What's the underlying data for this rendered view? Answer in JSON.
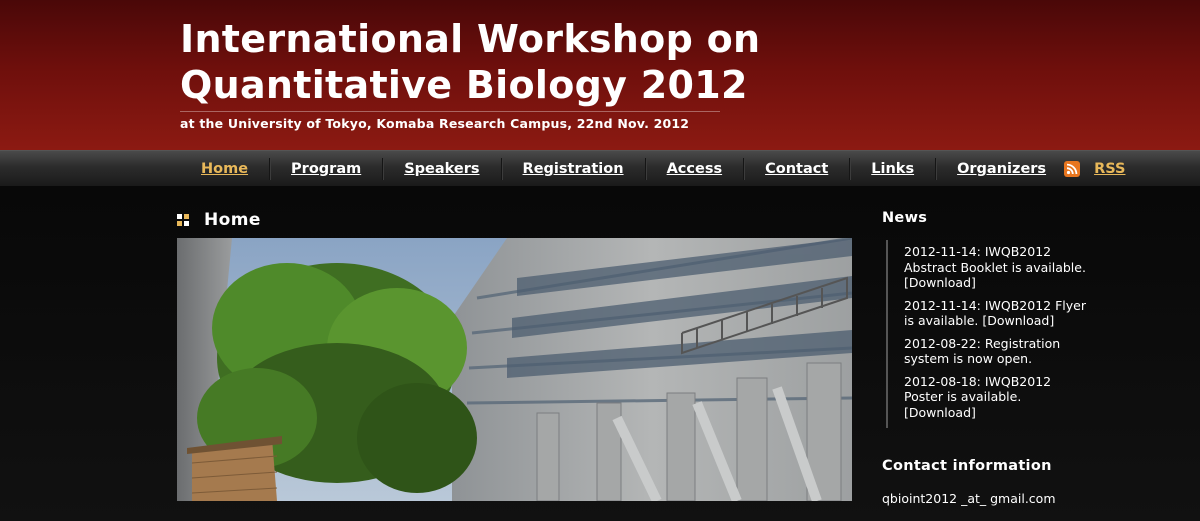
{
  "header": {
    "title_line1": "International Workshop on",
    "title_line2": "Quantitative Biology 2012",
    "subtitle": "at the University of Tokyo, Komaba Research Campus, 22nd Nov. 2012"
  },
  "nav": {
    "items": [
      {
        "label": "Home",
        "active": true
      },
      {
        "label": "Program"
      },
      {
        "label": "Speakers"
      },
      {
        "label": "Registration"
      },
      {
        "label": "Access"
      },
      {
        "label": "Contact"
      },
      {
        "label": "Links"
      },
      {
        "label": "Organizers"
      }
    ],
    "rss_label": "RSS",
    "rss_icon": "rss-icon"
  },
  "main": {
    "section_title": "Home",
    "section_icon": "square-bullet-icon"
  },
  "sidebar": {
    "news_title": "News",
    "news": [
      "2012-11-14: IWQB2012 Abstract Booklet is available. [Download]",
      "2012-11-14: IWQB2012 Flyer is available. [Download]",
      "2012-08-22: Registration system is now open.",
      "2012-08-18: IWQB2012 Poster is available. [Download]"
    ],
    "contact_title": "Contact information",
    "contact_email": "qbioint2012 _at_ gmail.com"
  },
  "colors": {
    "header_dark": "#4a0808",
    "header_light": "#8c1a12",
    "nav_active": "#e8b85a",
    "rss_orange": "#e8761f"
  }
}
